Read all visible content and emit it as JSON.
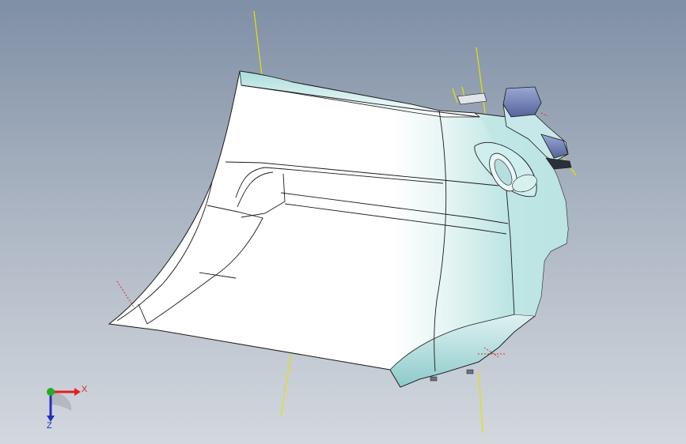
{
  "viewport": {
    "background_top": "#7f8fa5",
    "background_bottom": "#d3d8de"
  },
  "model": {
    "shading_color": "#bfe6e4",
    "edge_color": "#1a1a1a",
    "reference_axis_color": "#e8e000",
    "sketch_line_color": "#d03030",
    "fixture_color": "#6e7fb2"
  },
  "triad": {
    "x_label": "X",
    "z_label": "Z",
    "x_color": "#e02020",
    "y_color": "#20b020",
    "z_color": "#2030c0"
  }
}
